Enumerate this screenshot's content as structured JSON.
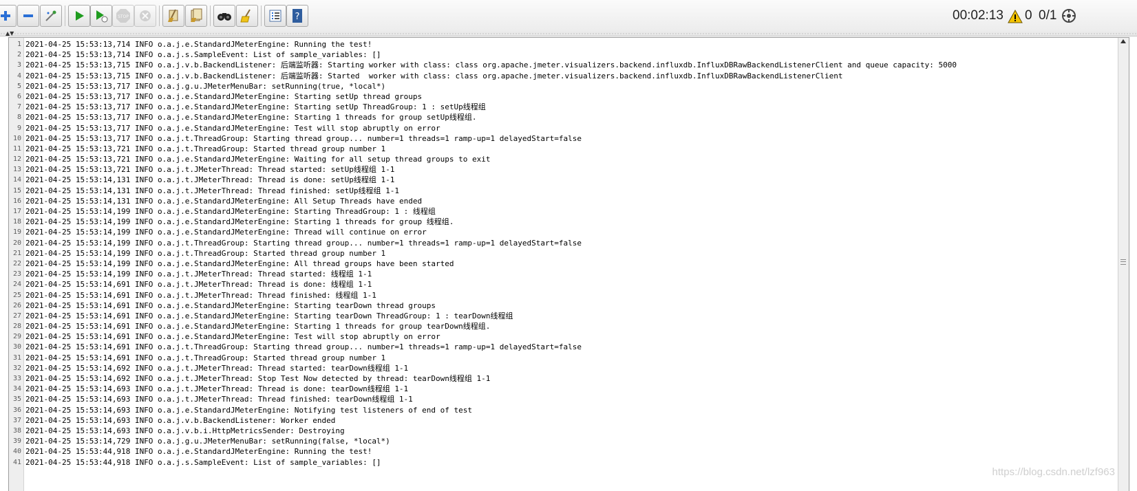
{
  "toolbar": {
    "buttons": [
      {
        "name": "expand-button",
        "icon": "plus-icon"
      },
      {
        "name": "collapse-button",
        "icon": "minus-icon"
      },
      {
        "name": "toggle-button",
        "icon": "toggle-wand-icon"
      },
      {
        "name": "start-button",
        "icon": "play-icon"
      },
      {
        "name": "start-no-pauses-button",
        "icon": "play-timer-icon"
      },
      {
        "name": "stop-button",
        "icon": "stop-icon"
      },
      {
        "name": "shutdown-button",
        "icon": "shutdown-icon"
      },
      {
        "name": "clear-button",
        "icon": "broom-clear-icon"
      },
      {
        "name": "clear-all-button",
        "icon": "broom-clear-all-icon"
      },
      {
        "name": "search-button",
        "icon": "binoculars-icon"
      },
      {
        "name": "reset-search-button",
        "icon": "reset-search-broom-icon"
      },
      {
        "name": "function-helper-button",
        "icon": "list-icon"
      },
      {
        "name": "help-button",
        "icon": "help-book-icon"
      }
    ],
    "elapsed_time": "00:02:13",
    "warning_count": "0",
    "active_threads": "0/1"
  },
  "log": {
    "lines": [
      {
        "n": "1",
        "text": "2021-04-25 15:53:13,714 INFO o.a.j.e.StandardJMeterEngine: Running the test!"
      },
      {
        "n": "2",
        "text": "2021-04-25 15:53:13,714 INFO o.a.j.s.SampleEvent: List of sample_variables: []"
      },
      {
        "n": "3",
        "text": "2021-04-25 15:53:13,715 INFO o.a.j.v.b.BackendListener: 后端监听器: Starting worker with class: class org.apache.jmeter.visualizers.backend.influxdb.InfluxDBRawBackendListenerClient and queue capacity: 5000"
      },
      {
        "n": "4",
        "text": "2021-04-25 15:53:13,715 INFO o.a.j.v.b.BackendListener: 后端监听器: Started  worker with class: class org.apache.jmeter.visualizers.backend.influxdb.InfluxDBRawBackendListenerClient"
      },
      {
        "n": "5",
        "text": "2021-04-25 15:53:13,717 INFO o.a.j.g.u.JMeterMenuBar: setRunning(true, *local*)"
      },
      {
        "n": "6",
        "text": "2021-04-25 15:53:13,717 INFO o.a.j.e.StandardJMeterEngine: Starting setUp thread groups"
      },
      {
        "n": "7",
        "text": "2021-04-25 15:53:13,717 INFO o.a.j.e.StandardJMeterEngine: Starting setUp ThreadGroup: 1 : setUp线程组"
      },
      {
        "n": "8",
        "text": "2021-04-25 15:53:13,717 INFO o.a.j.e.StandardJMeterEngine: Starting 1 threads for group setUp线程组."
      },
      {
        "n": "9",
        "text": "2021-04-25 15:53:13,717 INFO o.a.j.e.StandardJMeterEngine: Test will stop abruptly on error"
      },
      {
        "n": "10",
        "text": "2021-04-25 15:53:13,717 INFO o.a.j.t.ThreadGroup: Starting thread group... number=1 threads=1 ramp-up=1 delayedStart=false"
      },
      {
        "n": "11",
        "text": "2021-04-25 15:53:13,721 INFO o.a.j.t.ThreadGroup: Started thread group number 1"
      },
      {
        "n": "12",
        "text": "2021-04-25 15:53:13,721 INFO o.a.j.e.StandardJMeterEngine: Waiting for all setup thread groups to exit"
      },
      {
        "n": "13",
        "text": "2021-04-25 15:53:13,721 INFO o.a.j.t.JMeterThread: Thread started: setUp线程组 1-1"
      },
      {
        "n": "14",
        "text": "2021-04-25 15:53:14,131 INFO o.a.j.t.JMeterThread: Thread is done: setUp线程组 1-1"
      },
      {
        "n": "15",
        "text": "2021-04-25 15:53:14,131 INFO o.a.j.t.JMeterThread: Thread finished: setUp线程组 1-1"
      },
      {
        "n": "16",
        "text": "2021-04-25 15:53:14,131 INFO o.a.j.e.StandardJMeterEngine: All Setup Threads have ended"
      },
      {
        "n": "17",
        "text": "2021-04-25 15:53:14,199 INFO o.a.j.e.StandardJMeterEngine: Starting ThreadGroup: 1 : 线程组"
      },
      {
        "n": "18",
        "text": "2021-04-25 15:53:14,199 INFO o.a.j.e.StandardJMeterEngine: Starting 1 threads for group 线程组."
      },
      {
        "n": "19",
        "text": "2021-04-25 15:53:14,199 INFO o.a.j.e.StandardJMeterEngine: Thread will continue on error"
      },
      {
        "n": "20",
        "text": "2021-04-25 15:53:14,199 INFO o.a.j.t.ThreadGroup: Starting thread group... number=1 threads=1 ramp-up=1 delayedStart=false"
      },
      {
        "n": "21",
        "text": "2021-04-25 15:53:14,199 INFO o.a.j.t.ThreadGroup: Started thread group number 1"
      },
      {
        "n": "22",
        "text": "2021-04-25 15:53:14,199 INFO o.a.j.e.StandardJMeterEngine: All thread groups have been started"
      },
      {
        "n": "23",
        "text": "2021-04-25 15:53:14,199 INFO o.a.j.t.JMeterThread: Thread started: 线程组 1-1"
      },
      {
        "n": "24",
        "text": "2021-04-25 15:53:14,691 INFO o.a.j.t.JMeterThread: Thread is done: 线程组 1-1"
      },
      {
        "n": "25",
        "text": "2021-04-25 15:53:14,691 INFO o.a.j.t.JMeterThread: Thread finished: 线程组 1-1"
      },
      {
        "n": "26",
        "text": "2021-04-25 15:53:14,691 INFO o.a.j.e.StandardJMeterEngine: Starting tearDown thread groups"
      },
      {
        "n": "27",
        "text": "2021-04-25 15:53:14,691 INFO o.a.j.e.StandardJMeterEngine: Starting tearDown ThreadGroup: 1 : tearDown线程组"
      },
      {
        "n": "28",
        "text": "2021-04-25 15:53:14,691 INFO o.a.j.e.StandardJMeterEngine: Starting 1 threads for group tearDown线程组."
      },
      {
        "n": "29",
        "text": "2021-04-25 15:53:14,691 INFO o.a.j.e.StandardJMeterEngine: Test will stop abruptly on error"
      },
      {
        "n": "30",
        "text": "2021-04-25 15:53:14,691 INFO o.a.j.t.ThreadGroup: Starting thread group... number=1 threads=1 ramp-up=1 delayedStart=false"
      },
      {
        "n": "31",
        "text": "2021-04-25 15:53:14,691 INFO o.a.j.t.ThreadGroup: Started thread group number 1"
      },
      {
        "n": "32",
        "text": "2021-04-25 15:53:14,692 INFO o.a.j.t.JMeterThread: Thread started: tearDown线程组 1-1"
      },
      {
        "n": "33",
        "text": "2021-04-25 15:53:14,692 INFO o.a.j.t.JMeterThread: Stop Test Now detected by thread: tearDown线程组 1-1"
      },
      {
        "n": "34",
        "text": "2021-04-25 15:53:14,693 INFO o.a.j.t.JMeterThread: Thread is done: tearDown线程组 1-1"
      },
      {
        "n": "35",
        "text": "2021-04-25 15:53:14,693 INFO o.a.j.t.JMeterThread: Thread finished: tearDown线程组 1-1"
      },
      {
        "n": "36",
        "text": "2021-04-25 15:53:14,693 INFO o.a.j.e.StandardJMeterEngine: Notifying test listeners of end of test"
      },
      {
        "n": "37",
        "text": "2021-04-25 15:53:14,693 INFO o.a.j.v.b.BackendListener: Worker ended"
      },
      {
        "n": "38",
        "text": "2021-04-25 15:53:14,693 INFO o.a.j.v.b.i.HttpMetricsSender: Destroying"
      },
      {
        "n": "39",
        "text": "2021-04-25 15:53:14,729 INFO o.a.j.g.u.JMeterMenuBar: setRunning(false, *local*)"
      },
      {
        "n": "40",
        "text": "2021-04-25 15:53:44,918 INFO o.a.j.e.StandardJMeterEngine: Running the test!"
      },
      {
        "n": "41",
        "text": "2021-04-25 15:53:44,918 INFO o.a.j.s.SampleEvent: List of sample_variables: []"
      }
    ]
  },
  "watermark": "https://blog.csdn.net/lzf963"
}
